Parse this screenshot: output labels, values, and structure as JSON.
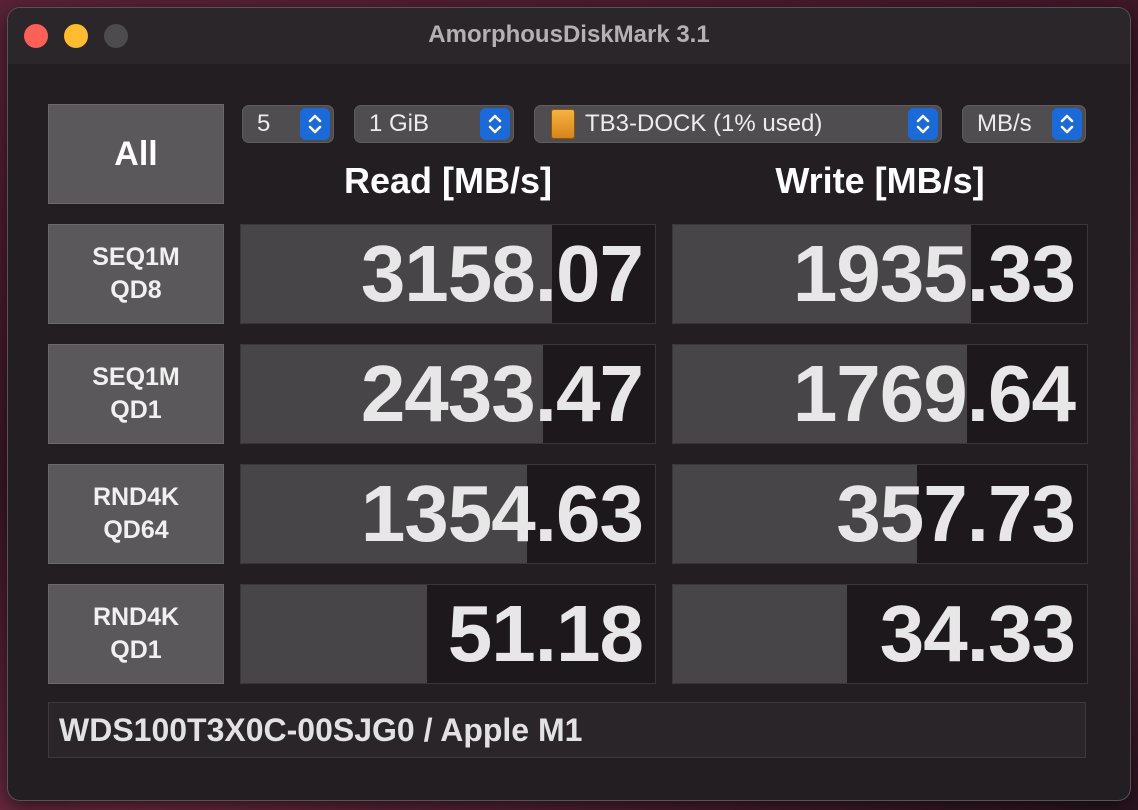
{
  "window": {
    "title": "AmorphousDiskMark 3.1"
  },
  "toolbar": {
    "all_label": "All",
    "count": "5",
    "size": "1 GiB",
    "disk": "TB3-DOCK (1% used)",
    "unit": "MB/s"
  },
  "headers": {
    "read": "Read [MB/s]",
    "write": "Write [MB/s]"
  },
  "rows": [
    {
      "line1": "SEQ1M",
      "line2": "QD8",
      "read": "3158.07",
      "write": "1935.33",
      "read_fill": 0.75,
      "write_fill": 0.72
    },
    {
      "line1": "SEQ1M",
      "line2": "QD1",
      "read": "2433.47",
      "write": "1769.64",
      "read_fill": 0.73,
      "write_fill": 0.71
    },
    {
      "line1": "RND4K",
      "line2": "QD64",
      "read": "1354.63",
      "write": "357.73",
      "read_fill": 0.69,
      "write_fill": 0.59
    },
    {
      "line1": "RND4K",
      "line2": "QD1",
      "read": "51.18",
      "write": "34.33",
      "read_fill": 0.45,
      "write_fill": 0.42
    }
  ],
  "footer": {
    "device": "WDS100T3X0C-00SJG0 / Apple M1"
  },
  "colors": {
    "accent": "#1c6ad8",
    "disk_icon": "#e8961f",
    "close": "#fe5f57",
    "minimize": "#febc2e"
  }
}
